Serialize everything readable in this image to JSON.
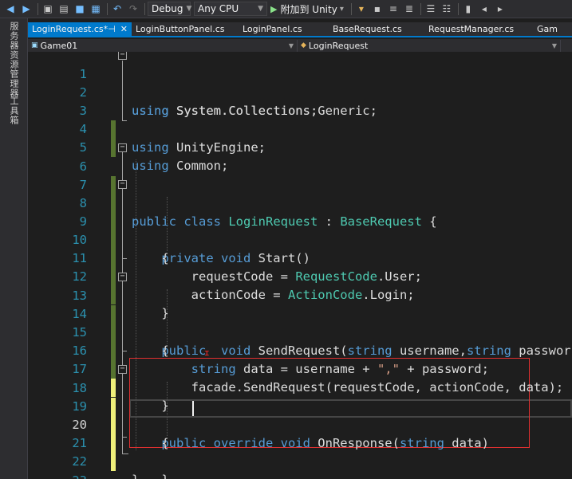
{
  "toolbar": {
    "config": "Debug",
    "platform": "Any CPU",
    "attach_label": "附加到 Unity",
    "attach_arrow": "▾"
  },
  "left_dock": {
    "tabs": [
      "服务器资源管理器",
      "工具箱"
    ]
  },
  "tabs": [
    {
      "label": "LoginRequest.cs*",
      "active": true
    },
    {
      "label": "LoginButtonPanel.cs",
      "active": false
    },
    {
      "label": "LoginPanel.cs",
      "active": false
    },
    {
      "label": "BaseRequest.cs",
      "active": false
    },
    {
      "label": "RequestManager.cs",
      "active": false
    },
    {
      "label": "Gam",
      "active": false
    }
  ],
  "navbar": {
    "project": "Game01",
    "type": "LoginRequest"
  },
  "editor": {
    "line_numbers": [
      "1",
      "2",
      "3",
      "4",
      "5",
      "6",
      "7",
      "8",
      "9",
      "10",
      "11",
      "12",
      "13",
      "14",
      "15",
      "16",
      "17",
      "18",
      "19",
      "20",
      "21",
      "22",
      "23"
    ],
    "lines": [
      {
        "t1": "using ",
        "t2": "System.Collections;"
      },
      {
        "t1": "using ",
        "t2": "System.Collections.Generic;"
      },
      {
        "t1": "using ",
        "t2": "UnityEngine;"
      },
      {
        "t1": "using ",
        "t2": "Common;"
      },
      {
        "t1": "",
        "t2": ""
      },
      {
        "t1": "public class ",
        "t2": "LoginRequest",
        "t3": " : ",
        "t4": "BaseRequest",
        "t5": " {"
      },
      {
        "t1": "",
        "t2": ""
      },
      {
        "t1": "    private void ",
        "t2": "Start()"
      },
      {
        "t1": "    {"
      },
      {
        "t1": "        requestCode = ",
        "t2": "RequestCode",
        "t3": ".User;"
      },
      {
        "t1": "        actionCode = ",
        "t2": "ActionCode",
        "t3": ".Login;"
      },
      {
        "t1": "    }"
      },
      {
        "t1": "    public  void ",
        "t2": "SendRequest(",
        "t3": "string",
        "t4": " username,",
        "t5": "string",
        "t6": " passwor"
      },
      {
        "t1": "    {"
      },
      {
        "t1": "        ",
        "t2": "string",
        "t3": " data = username + ",
        "t4": "\",\"",
        "t5": " + password;"
      },
      {
        "t1": "        facade.SendRequest(requestCode, actionCode, data);"
      },
      {
        "t1": "    }"
      },
      {
        "t1": "    public override void ",
        "t2": "OnResponse(",
        "t3": "string",
        "t4": " data)"
      },
      {
        "t1": "    {"
      },
      {
        "t1": ""
      },
      {
        "t1": "    }"
      },
      {
        "t1": "}"
      },
      {
        "t1": ""
      }
    ]
  },
  "colors": {
    "keyword": "#569cd6",
    "type": "#4ec9b0",
    "string": "#d69d85",
    "line_number": "#2b91af",
    "accent": "#007acc",
    "highlight_box": "#e03030"
  }
}
